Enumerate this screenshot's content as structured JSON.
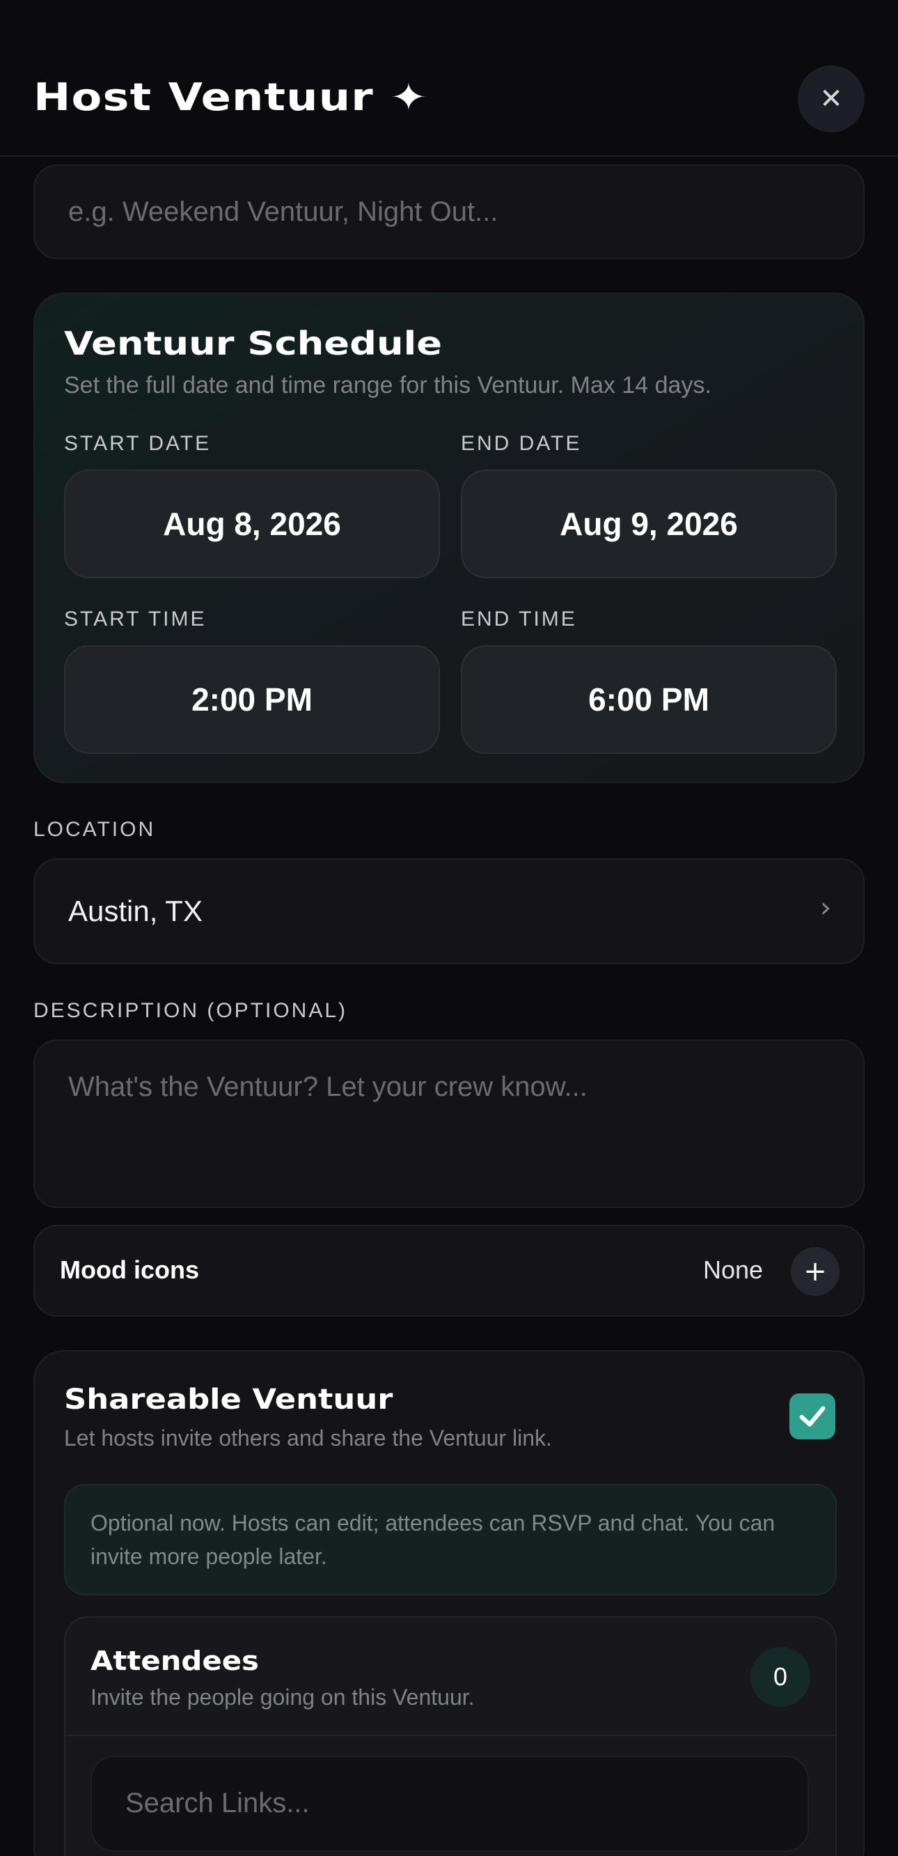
{
  "header": {
    "title": "Host Ventuur ✦",
    "close_icon": "close-icon"
  },
  "name_field": {
    "placeholder": "e.g. Weekend Ventuur, Night Out..."
  },
  "schedule": {
    "title": "Ventuur Schedule",
    "subtitle": "Set the full date and time range for this Ventuur. Max 14 days.",
    "start_date_label": "START DATE",
    "start_date": "Aug 8, 2026",
    "end_date_label": "END DATE",
    "end_date": "Aug 9, 2026",
    "start_time_label": "START TIME",
    "start_time": "2:00 PM",
    "end_time_label": "END TIME",
    "end_time": "6:00 PM"
  },
  "location": {
    "label": "LOCATION",
    "value": "Austin, TX",
    "chevron": "›"
  },
  "description": {
    "label": "DESCRIPTION (OPTIONAL)",
    "placeholder": "What's the Ventuur? Let your crew know..."
  },
  "mood": {
    "label": "Mood icons",
    "value": "None",
    "add": "+"
  },
  "share": {
    "title": "Shareable Ventuur",
    "subtitle": "Let hosts invite others and share the Ventuur link.",
    "checked": true,
    "accent_color": "#2f9e8d",
    "note": "Optional now. Hosts can edit; attendees can RSVP and chat. You can invite more people later."
  },
  "attendees": {
    "title": "Attendees",
    "subtitle": "Invite the people going on this Ventuur.",
    "count": "0",
    "search_placeholder": "Search Links..."
  }
}
